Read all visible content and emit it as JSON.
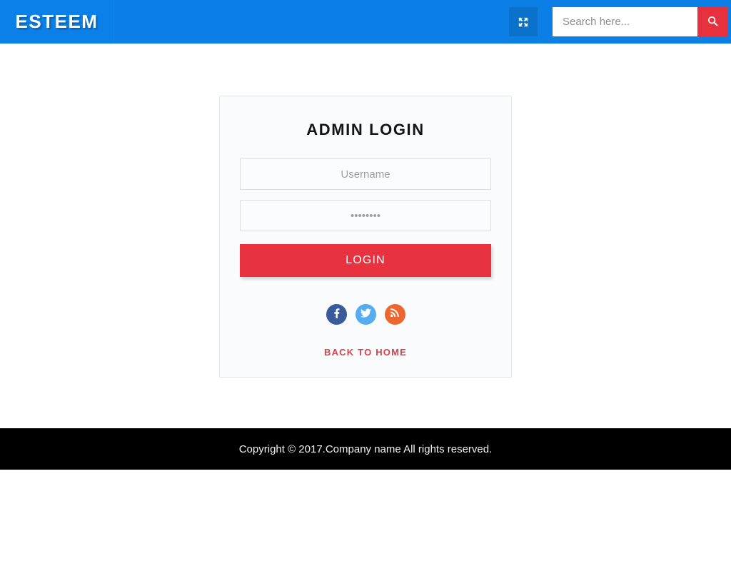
{
  "header": {
    "logo_text": "ESTEEM",
    "fullscreen_icon": "expand-arrows-icon",
    "search": {
      "placeholder": "Search here...",
      "value": "",
      "button_icon": "search-icon"
    },
    "colors": {
      "background": "#0b7fe6",
      "logo_background": "#0a80e8",
      "fullscreen_button": "#0b72cc",
      "search_button": "#e8313f"
    }
  },
  "login_card": {
    "title": "ADMIN LOGIN",
    "username_field": {
      "placeholder": "Username",
      "value": ""
    },
    "password_field": {
      "placeholder": "••••••••",
      "value": "",
      "masked_char_count": 8
    },
    "login_button_label": "LOGIN",
    "social_links": [
      {
        "name": "facebook",
        "icon": "facebook-icon",
        "color": "#3b5a9b"
      },
      {
        "name": "twitter",
        "icon": "twitter-icon",
        "color": "#55acee"
      },
      {
        "name": "rss",
        "icon": "rss-icon",
        "color": "#ec6630"
      }
    ],
    "back_link_label": "BACK TO HOME",
    "colors": {
      "card_background": "#fafbfc",
      "card_border": "#e4e6e8",
      "login_button": "#e8323f",
      "back_link": "#d9404c"
    }
  },
  "footer": {
    "copyright": "Copyright © 2017.Company name All rights reserved.",
    "background": "#000000"
  }
}
